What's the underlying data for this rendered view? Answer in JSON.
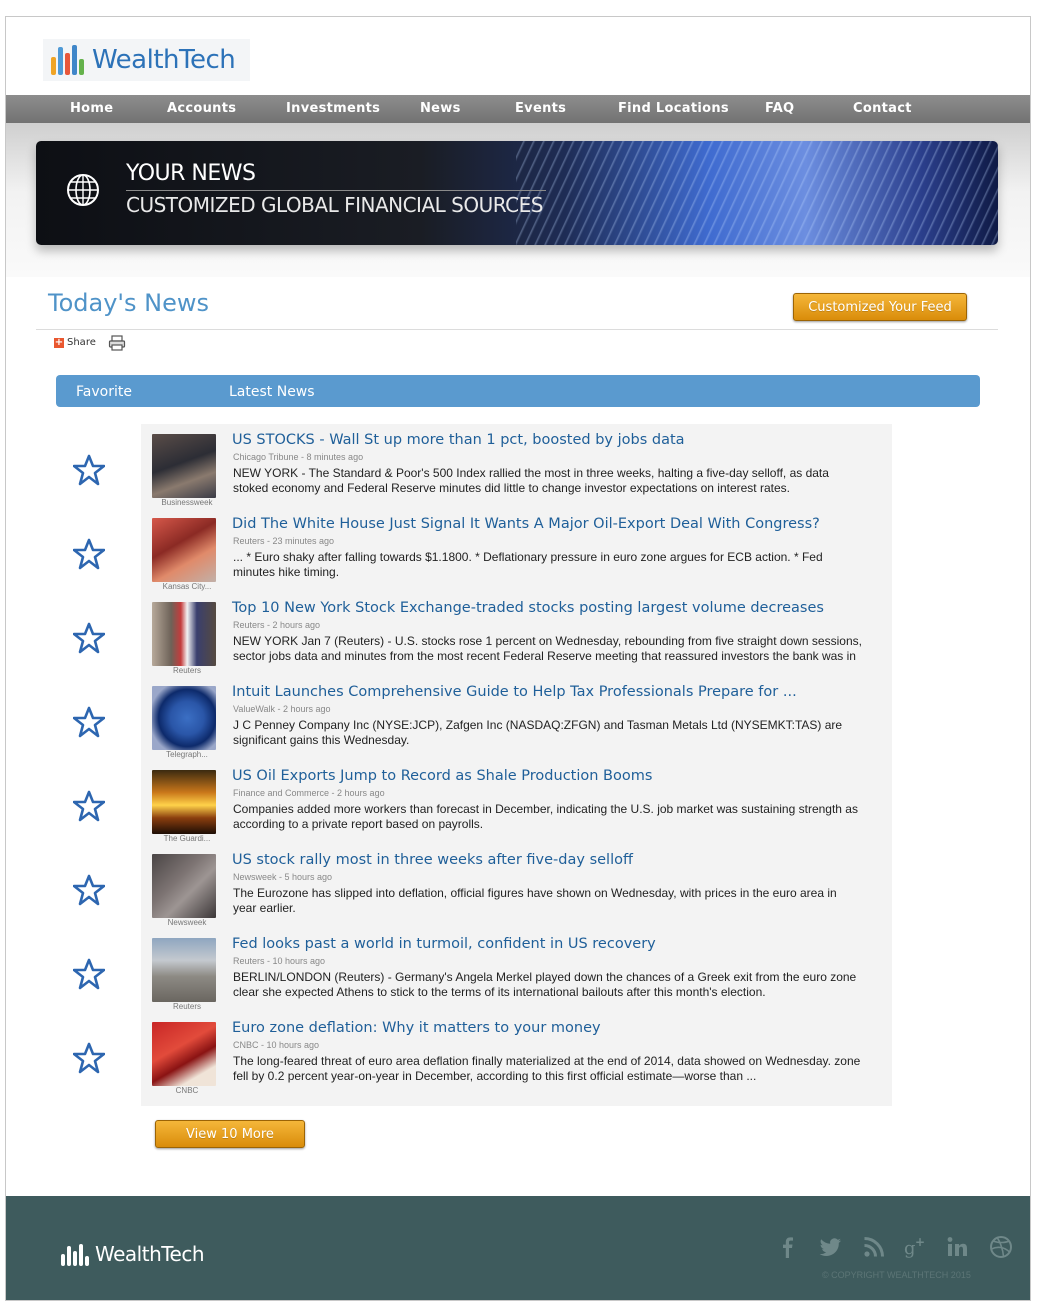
{
  "brand": {
    "name": "WealthTech",
    "colors": {
      "primary": "#2c72b8",
      "accent": "#f0a425",
      "tab": "#5a9acf",
      "footer": "#3e5b5d"
    }
  },
  "nav": {
    "items": [
      "Home",
      "Accounts",
      "Investments",
      "News",
      "Events",
      "Find Locations",
      "FAQ",
      "Contact"
    ]
  },
  "banner": {
    "line1": "YOUR NEWS",
    "line2": "CUSTOMIZED GLOBAL FINANCIAL SOURCES",
    "icon": "globe-icon"
  },
  "page": {
    "title": "Today's News",
    "customize_label": "Customized Your Feed",
    "share_label": "Share",
    "share_plus": "+",
    "tabs": {
      "favorite": "Favorite",
      "latest": "Latest News"
    },
    "view_more_label": "View 10 More"
  },
  "news": [
    {
      "headline": "US STOCKS - Wall St up more than 1 pct, boosted by jobs data",
      "meta": "Chicago Tribune - 8 minutes ago",
      "summary": "NEW YORK - The Standard & Poor's 500 Index rallied the most in three weeks, halting a five-day selloff, as data stoked economy and Federal Reserve minutes did little to change investor expectations on interest rates.",
      "thumb_source": "Businessweek"
    },
    {
      "headline": "Did The White House Just Signal It Wants A Major Oil-Export Deal With Congress?",
      "meta": "Reuters - 23 minutes ago",
      "summary": "... * Euro shaky after falling towards $1.1800. * Deflationary pressure in euro zone argues for ECB action. * Fed minutes hike timing.",
      "thumb_source": "Kansas City..."
    },
    {
      "headline": "Top 10 New York Stock Exchange-traded stocks posting largest volume decreases",
      "meta": "Reuters - 2 hours ago",
      "summary": "NEW YORK Jan 7 (Reuters) - U.S. stocks rose 1 percent on Wednesday, rebounding from five straight down sessions, sector jobs data and minutes from the most recent Federal Reserve meeting that reassured investors the bank was in",
      "thumb_source": "Reuters"
    },
    {
      "headline": "Intuit Launches Comprehensive Guide to Help Tax Professionals Prepare for ...",
      "meta": "ValueWalk - 2 hours ago",
      "summary": "J C Penney Company Inc (NYSE:JCP), Zafgen Inc (NASDAQ:ZFGN) and Tasman Metals Ltd (NYSEMKT:TAS) are significant gains this Wednesday.",
      "thumb_source": "Telegraph..."
    },
    {
      "headline": "US Oil Exports Jump to Record as Shale Production Booms",
      "meta": "Finance and Commerce - 2 hours ago",
      "summary": "Companies added more workers than forecast in December, indicating the U.S. job market was sustaining strength as according to a private report based on payrolls.",
      "thumb_source": "The Guardi..."
    },
    {
      "headline": "US stock rally most in three weeks after five-day selloff",
      "meta": "Newsweek - 5 hours ago",
      "summary": "The Eurozone has slipped into deflation, official figures have shown on Wednesday, with prices in the euro area in year earlier.",
      "thumb_source": "Newsweek"
    },
    {
      "headline": "Fed looks past a world in turmoil, confident in US recovery",
      "meta": "Reuters - 10 hours ago",
      "summary": "BERLIN/LONDON (Reuters) - Germany's Angela Merkel played down the chances of a Greek exit from the euro zone clear she expected Athens to stick to the terms of its international bailouts after this month's election.",
      "thumb_source": "Reuters"
    },
    {
      "headline": "Euro zone deflation: Why it matters to your money",
      "meta": "CNBC - 10 hours ago",
      "summary": "The long-feared threat of euro area deflation finally materialized at the end of 2014, data showed on Wednesday. zone fell by 0.2 percent year-on-year in December, according to this first official estimate—worse than ...",
      "thumb_source": "CNBC"
    }
  ],
  "footer": {
    "brand": "WealthTech",
    "copyright": "© COPYRIGHT WEALTHTECH 2015",
    "social": [
      "facebook-icon",
      "twitter-icon",
      "rss-icon",
      "google-plus-icon",
      "linkedin-icon",
      "dribbble-icon"
    ]
  }
}
